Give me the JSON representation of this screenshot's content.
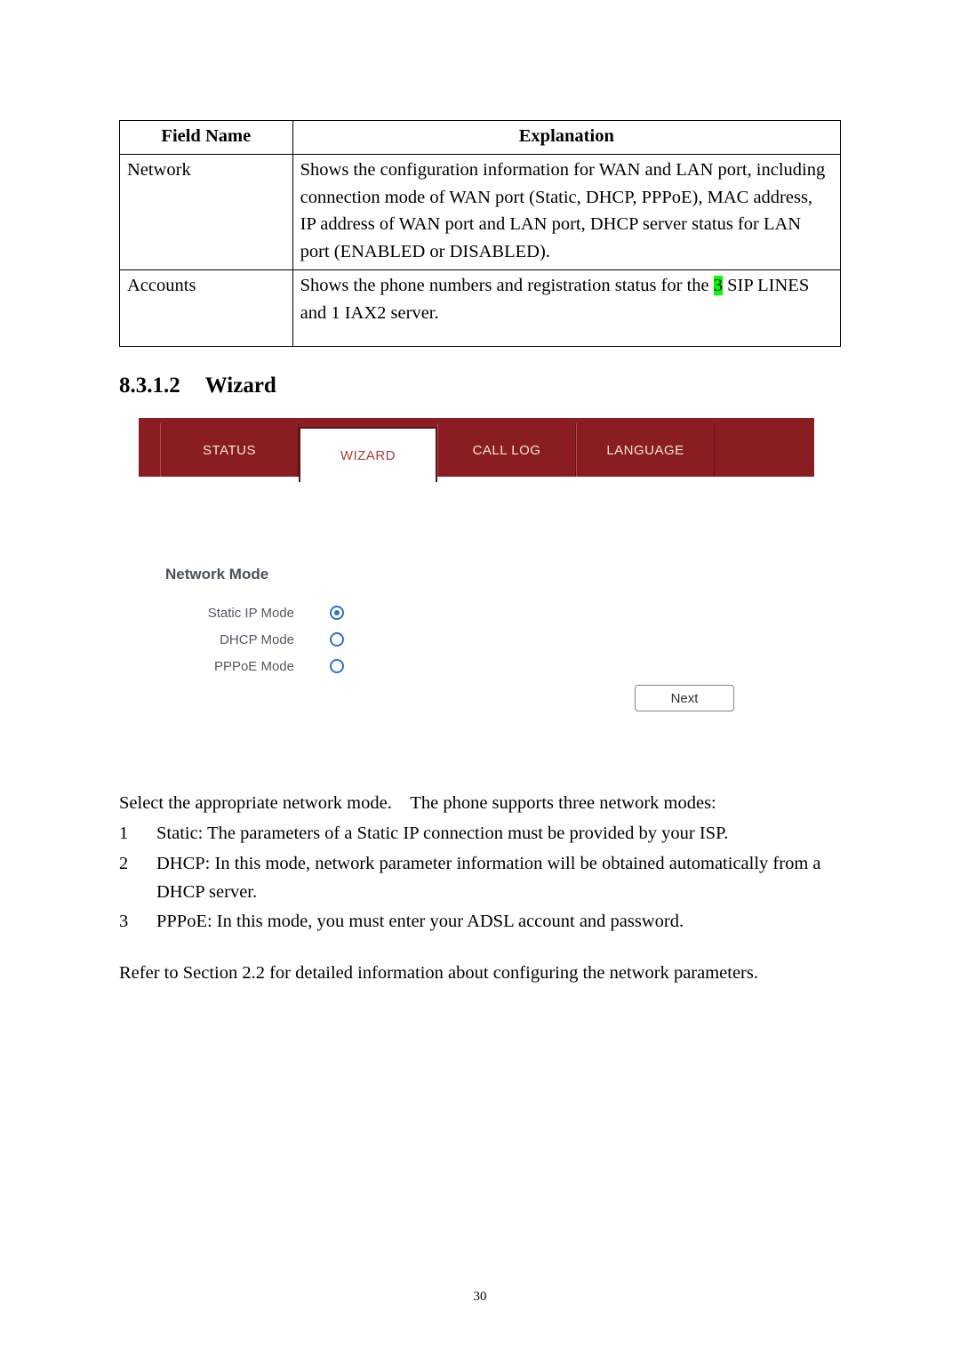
{
  "table": {
    "headers": {
      "field": "Field Name",
      "expl": "Explanation"
    },
    "rows": [
      {
        "field": "Network",
        "expl": "Shows the configuration information for WAN and LAN port, including connection mode of WAN port (Static, DHCP, PPPoE), MAC address, IP address of WAN port and LAN port, DHCP server status for LAN port (ENABLED or DISABLED)."
      },
      {
        "field": "Accounts",
        "expl_pre": "Shows the phone numbers and registration status for the ",
        "expl_hl": "3",
        "expl_post": " SIP LINES and 1 IAX2 server."
      }
    ]
  },
  "heading": {
    "number": "8.3.1.2",
    "title": "Wizard"
  },
  "screenshot": {
    "tabs": [
      {
        "label": "STATUS",
        "active": false
      },
      {
        "label": "WIZARD",
        "active": true
      },
      {
        "label": "CALL LOG",
        "active": false
      },
      {
        "label": "LANGUAGE",
        "active": false
      }
    ],
    "group_title": "Network Mode",
    "options": [
      {
        "label": "Static IP Mode",
        "checked": true
      },
      {
        "label": "DHCP Mode",
        "checked": false
      },
      {
        "label": "PPPoE Mode",
        "checked": false
      }
    ],
    "next_label": "Next"
  },
  "para_intro": "Select the appropriate network mode. The phone supports three network modes:",
  "modes": [
    {
      "n": "1",
      "t": "Static: The parameters of a Static IP connection must be provided by your ISP."
    },
    {
      "n": "2",
      "t": "DHCP: In this mode, network parameter information will be obtained automatically from a DHCP server."
    },
    {
      "n": "3",
      "t": "PPPoE: In this mode, you must enter your ADSL account and password."
    }
  ],
  "para_ref": "Refer to Section 2.2 for detailed information about configuring the network parameters.",
  "page_number": "30"
}
